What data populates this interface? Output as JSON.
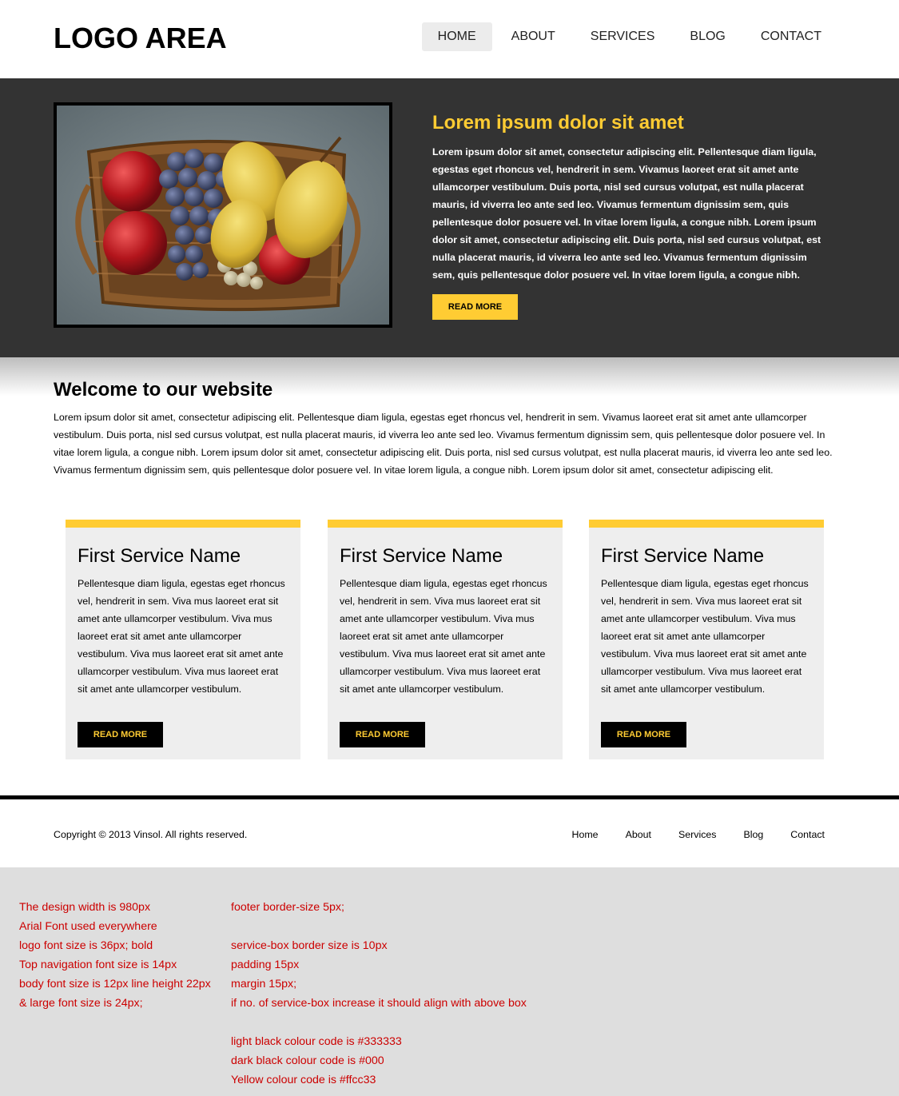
{
  "header": {
    "logo": "LOGO AREA",
    "nav": [
      "HOME",
      "ABOUT",
      "SERVICES",
      "BLOG",
      "CONTACT"
    ],
    "active_index": 0
  },
  "hero": {
    "image_alt": "Basket of fruit with apples, pears and grapes",
    "title": "Lorem ipsum dolor sit amet",
    "text": "Lorem ipsum dolor sit amet, consectetur adipiscing elit. Pellentesque diam ligula, egestas eget rhoncus vel, hendrerit in sem. Vivamus laoreet erat sit amet ante ullamcorper vestibulum. Duis porta, nisl sed cursus volutpat, est nulla placerat mauris, id viverra leo ante sed leo. Vivamus fermentum dignissim sem, quis pellentesque dolor posuere vel. In vitae lorem ligula, a congue nibh. Lorem ipsum dolor sit amet, consectetur adipiscing elit. Duis porta, nisl sed cursus volutpat, est nulla placerat mauris, id viverra leo ante sed leo. Vivamus fermentum dignissim sem, quis pellentesque dolor posuere vel. In vitae lorem ligula, a congue nibh.",
    "button": "READ MORE"
  },
  "welcome": {
    "title": "Welcome to our website",
    "text": "Lorem ipsum dolor sit amet, consectetur adipiscing elit. Pellentesque diam ligula, egestas eget rhoncus vel, hendrerit in sem. Vivamus laoreet erat sit amet ante ullamcorper vestibulum. Duis porta, nisl sed cursus volutpat, est nulla placerat mauris, id viverra leo ante sed leo. Vivamus fermentum dignissim sem, quis pellentesque dolor posuere vel. In vitae lorem ligula, a congue nibh. Lorem ipsum dolor sit amet, consectetur adipiscing elit. Duis porta, nisl sed cursus volutpat, est nulla placerat mauris, id viverra leo ante sed leo. Vivamus fermentum dignissim sem, quis pellentesque dolor posuere vel. In vitae lorem ligula, a congue nibh. Lorem ipsum dolor sit amet, consectetur adipiscing elit."
  },
  "services": [
    {
      "name": "First Service Name",
      "text": "Pellentesque diam ligula, egestas eget rhoncus vel, hendrerit in sem. Viva mus laoreet erat sit amet ante ullamcorper vestibulum. Viva mus laoreet erat sit amet ante ullamcorper vestibulum. Viva mus laoreet erat sit amet ante ullamcorper vestibulum. Viva mus laoreet erat sit amet ante ullamcorper vestibulum.",
      "button": "READ MORE"
    },
    {
      "name": "First Service Name",
      "text": "Pellentesque diam ligula, egestas eget rhoncus vel, hendrerit in sem. Viva mus laoreet erat sit amet ante ullamcorper vestibulum. Viva mus laoreet erat sit amet ante ullamcorper vestibulum. Viva mus laoreet erat sit amet ante ullamcorper vestibulum. Viva mus laoreet erat sit amet ante ullamcorper vestibulum.",
      "button": "READ MORE"
    },
    {
      "name": "First Service Name",
      "text": "Pellentesque diam ligula, egestas eget rhoncus vel, hendrerit in sem. Viva mus laoreet erat sit amet ante ullamcorper vestibulum. Viva mus laoreet erat sit amet ante ullamcorper vestibulum. Viva mus laoreet erat sit amet ante ullamcorper vestibulum. Viva mus laoreet erat sit amet ante ullamcorper vestibulum.",
      "button": "READ MORE"
    }
  ],
  "footer": {
    "copyright": "Copyright © 2013 Vinsol. All rights reserved.",
    "links": [
      "Home",
      "About",
      "Services",
      "Blog",
      "Contact"
    ]
  },
  "notes": {
    "left": [
      "The design width is 980px",
      "Arial Font used everywhere",
      "logo font size is 36px; bold",
      "Top navigation font size is 14px",
      "body font size is 12px line height 22px",
      "& large font size is 24px;"
    ],
    "right": [
      "footer border-size 5px;",
      "",
      "service-box border size is 10px",
      "padding 15px",
      "margin 15px;",
      "if no. of service-box increase it should align with above box",
      "",
      "light black colour code is #333333",
      "dark black colour code is #000",
      "Yellow colour code is #ffcc33"
    ]
  },
  "colors": {
    "light_black": "#333333",
    "dark_black": "#000000",
    "yellow": "#ffcc33",
    "notes_red": "#cc0000"
  }
}
